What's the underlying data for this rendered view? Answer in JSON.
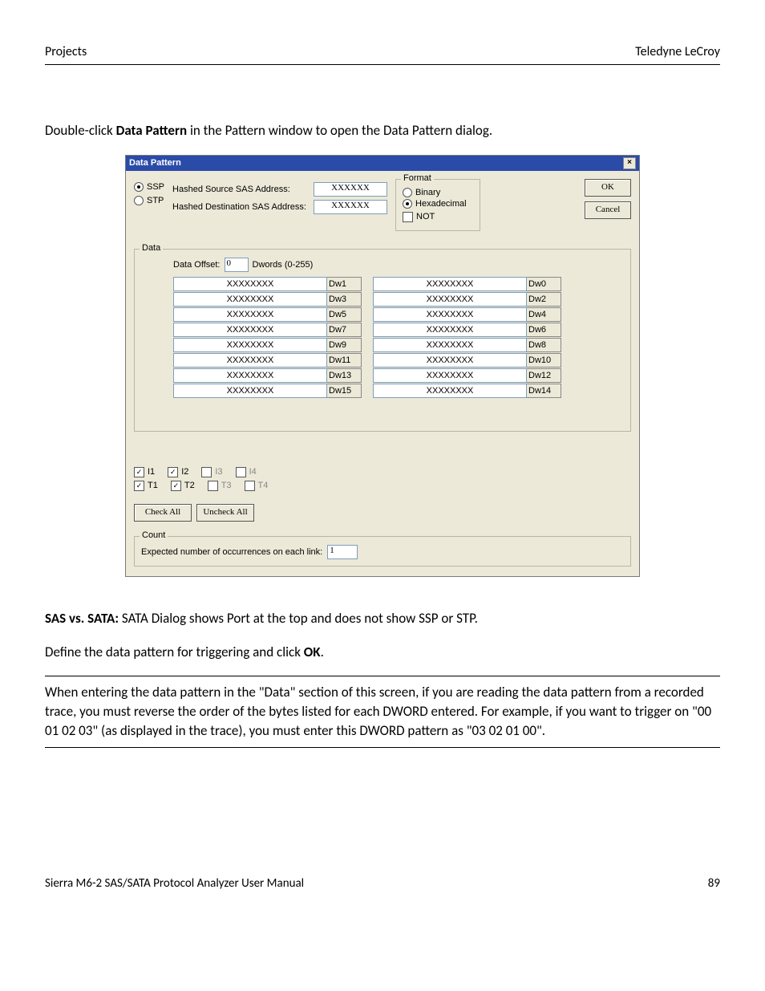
{
  "header": {
    "left": "Projects",
    "right": "Teledyne LeCroy"
  },
  "intro": {
    "pre": "Double-click ",
    "bold": "Data Pattern",
    "post": " in the Pattern window to open the Data Pattern dialog."
  },
  "dialog": {
    "title": "Data Pattern",
    "protocol": {
      "ssp": "SSP",
      "stp": "STP"
    },
    "addr": {
      "src_label": "Hashed Source SAS Address:",
      "dst_label": "Hashed Destination SAS Address:",
      "src_val": "XXXXXX",
      "dst_val": "XXXXXX"
    },
    "format": {
      "legend": "Format",
      "binary": "Binary",
      "hex": "Hexadecimal",
      "not": "NOT"
    },
    "buttons": {
      "ok": "OK",
      "cancel": "Cancel"
    },
    "data": {
      "legend": "Data",
      "offset_label": "Data Offset:",
      "offset_val": "0",
      "offset_range": "Dwords (0-255)",
      "rows": [
        {
          "l_val": "XXXXXXXX",
          "l_lbl": "Dw1",
          "r_val": "XXXXXXXX",
          "r_lbl": "Dw0"
        },
        {
          "l_val": "XXXXXXXX",
          "l_lbl": "Dw3",
          "r_val": "XXXXXXXX",
          "r_lbl": "Dw2"
        },
        {
          "l_val": "XXXXXXXX",
          "l_lbl": "Dw5",
          "r_val": "XXXXXXXX",
          "r_lbl": "Dw4"
        },
        {
          "l_val": "XXXXXXXX",
          "l_lbl": "Dw7",
          "r_val": "XXXXXXXX",
          "r_lbl": "Dw6"
        },
        {
          "l_val": "XXXXXXXX",
          "l_lbl": "Dw9",
          "r_val": "XXXXXXXX",
          "r_lbl": "Dw8"
        },
        {
          "l_val": "XXXXXXXX",
          "l_lbl": "Dw11",
          "r_val": "XXXXXXXX",
          "r_lbl": "Dw10"
        },
        {
          "l_val": "XXXXXXXX",
          "l_lbl": "Dw13",
          "r_val": "XXXXXXXX",
          "r_lbl": "Dw12"
        },
        {
          "l_val": "XXXXXXXX",
          "l_lbl": "Dw15",
          "r_val": "XXXXXXXX",
          "r_lbl": "Dw14"
        }
      ]
    },
    "checks": {
      "row1": [
        "I1",
        "I2",
        "I3",
        "I4"
      ],
      "row2": [
        "T1",
        "T2",
        "T3",
        "T4"
      ],
      "check_all": "Check All",
      "uncheck_all": "Uncheck All"
    },
    "count": {
      "legend": "Count",
      "label": "Expected number of occurrences on each link:",
      "value": "1"
    }
  },
  "after": {
    "sas_bold": "SAS vs. SATA:",
    "sas_text": " SATA Dialog shows Port at the top and does not show SSP or STP.",
    "define_pre": "Define the data pattern for triggering and click ",
    "define_bold": "OK",
    "define_post": ".",
    "note": "When entering the data pattern in the \"Data\" section of this screen, if you are reading the data pattern from a recorded trace, you must reverse the order of the bytes listed for each DWORD entered. For example, if you want to trigger on \"00 01 02 03\" (as displayed in the trace), you must enter this DWORD pattern as \"03 02 01 00\"."
  },
  "footer": {
    "left": "Sierra M6-2 SAS/SATA Protocol Analyzer User Manual",
    "right": "89"
  }
}
